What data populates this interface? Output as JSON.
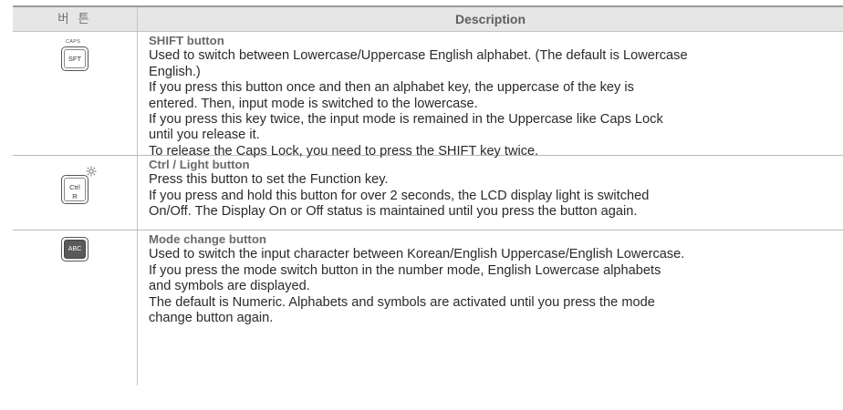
{
  "header": {
    "button_col": "버 튼",
    "desc_col": "Description"
  },
  "rows": [
    {
      "key": {
        "label": "SFT",
        "top_label": "CAPS"
      },
      "title": "SHIFT button",
      "lines": [
        "Used to switch between Lowercase/Uppercase English alphabet. (The default is Lowercase",
        "English.)",
        "If you press this button once and then an alphabet key, the uppercase of the key is",
        "entered. Then, input mode is switched to the lowercase.",
        "If you press this key twice, the input mode is remained in the Uppercase like Caps Lock",
        "until you release it.",
        "To release the Caps Lock, you need to press the SHIFT key twice."
      ]
    },
    {
      "key": {
        "label_1": "Ctrl",
        "label_2": "R",
        "icon": "light-icon"
      },
      "title": "Ctrl / Light button",
      "lines": [
        "Press this button to set the Function key.",
        "If you press and hold this button for over 2 seconds, the LCD display light is switched",
        "On/Off. The Display On or Off status is maintained until you press the button again."
      ]
    },
    {
      "key": {
        "label": "ABC"
      },
      "title": "Mode change button",
      "lines": [
        "Used to switch the input character between Korean/English Uppercase/English Lowercase.",
        "If you press the mode switch button in the number mode, English Lowercase alphabets",
        "and symbols are displayed.",
        "The default is Numeric. Alphabets and symbols are activated until you press the mode",
        "change button again."
      ]
    }
  ]
}
